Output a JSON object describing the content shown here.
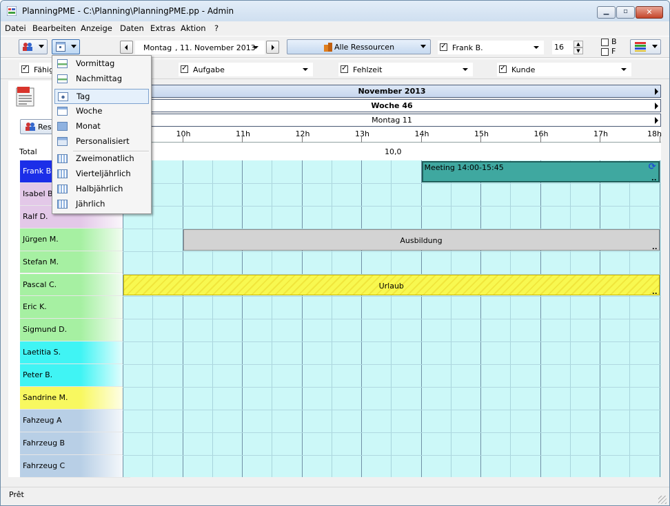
{
  "window": {
    "title": "PlanningPME - C:\\Planning\\PlanningPME.pp - Admin",
    "icon": "planning-app-icon",
    "controls": [
      "minimize-icon",
      "maximize-icon",
      "close-icon"
    ]
  },
  "menu": {
    "items": [
      "Datei",
      "Bearbeiten",
      "Anzeige",
      "Daten",
      "Extras",
      "Aktion",
      "?"
    ]
  },
  "toolbar": {
    "date": {
      "weekday": "Montag",
      "date": ", 11. November 2013"
    },
    "resource_filter": "Alle Ressourcen",
    "person_filter": "Frank B.",
    "count": "16",
    "b_label": "B",
    "f_label": "F"
  },
  "filters": {
    "faehigkeit": "Fähig",
    "aufgabe": "Aufgabe",
    "fehlzeit": "Fehlzeit",
    "kunde": "Kunde"
  },
  "view_menu": {
    "items": [
      {
        "label": "Vormittag",
        "icon": "half-day-icon"
      },
      {
        "label": "Nachmittag",
        "icon": "half-day-icon"
      },
      {
        "label": "Tag",
        "icon": "day-icon",
        "selected": true
      },
      {
        "label": "Woche",
        "icon": "week-icon"
      },
      {
        "label": "Monat",
        "icon": "month-icon"
      },
      {
        "label": "Personalisiert",
        "icon": "custom-view-icon"
      },
      {
        "label": "Zweimonatlich",
        "icon": "calendar-grid-icon"
      },
      {
        "label": "Vierteljährlich",
        "icon": "calendar-grid-icon"
      },
      {
        "label": "Halbjährlich",
        "icon": "calendar-grid-icon"
      },
      {
        "label": "Jährlich",
        "icon": "calendar-grid-icon"
      }
    ]
  },
  "left_panel": {
    "resources_button": "Ress",
    "total_label": "Total",
    "resources": [
      {
        "name": "Frank B.",
        "color": "#1c2ee8"
      },
      {
        "name": "Isabel B.",
        "color": "#e3c8e8"
      },
      {
        "name": "Ralf D.",
        "color": "#e3c8e8"
      },
      {
        "name": "Jürgen M.",
        "color": "#a6f0a2"
      },
      {
        "name": "Stefan M.",
        "color": "#a6f0a2"
      },
      {
        "name": "Pascal C.",
        "color": "#a6f0a2"
      },
      {
        "name": "Eric K.",
        "color": "#a6f0a2"
      },
      {
        "name": "Sigmund D.",
        "color": "#a6f0a2"
      },
      {
        "name": "Laetitia S.",
        "color": "#40f4f4"
      },
      {
        "name": "Peter B.",
        "color": "#40f4f4"
      },
      {
        "name": "Sandrine M.",
        "color": "#f8f860"
      },
      {
        "name": "Fahzeug A",
        "color": "#b8cfe6"
      },
      {
        "name": "Fahrzeug B",
        "color": "#b8cfe6"
      },
      {
        "name": "Fahrzeug C",
        "color": "#b8cfe6"
      }
    ]
  },
  "timeline": {
    "month": "November 2013",
    "week": "Woche 46",
    "day": "Montag 11",
    "hours": [
      "10h",
      "11h",
      "12h",
      "13h",
      "14h",
      "15h",
      "16h",
      "17h",
      "18h"
    ],
    "total_value": "10,0"
  },
  "events": [
    {
      "label": "Meeting  14:00-15:45",
      "row": 0,
      "start": 14.0,
      "end": 18.0,
      "color": "#3fa8a0",
      "icon": "recurring-icon"
    },
    {
      "label": "Ausbildung",
      "row": 3,
      "start": 10.0,
      "end": 18.0,
      "color": "#d3d3d3"
    },
    {
      "label": "Urlaub",
      "row": 5,
      "start": 9.0,
      "end": 18.0,
      "color": "#f8f850"
    }
  ],
  "status": {
    "text": "Prêt"
  },
  "colors": {
    "grid": "#ccf8f8",
    "selection": "#e5f0fb"
  }
}
